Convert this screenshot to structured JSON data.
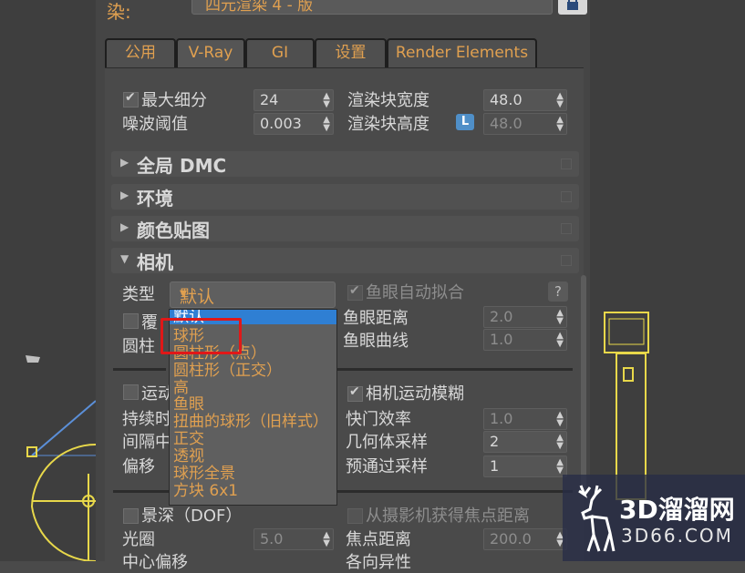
{
  "window": {
    "renderer_prefix": "染:",
    "renderer_value": "四元渲染 4 - 版"
  },
  "tabs": [
    {
      "label": "公用"
    },
    {
      "label": "V-Ray"
    },
    {
      "label": "GI"
    },
    {
      "label": "设置"
    },
    {
      "label": "Render Elements"
    }
  ],
  "image_sampler": {
    "max_subdivs_label": "最大细分",
    "max_subdivs_value": "24",
    "noise_label": "噪波阈值",
    "noise_value": "0.003",
    "bucket_width_label": "渲染块宽度",
    "bucket_width_value": "48.0",
    "bucket_height_label": "渲染块高度",
    "bucket_height_value": "48.0",
    "lock_label": "L"
  },
  "rollouts": [
    {
      "label": "全局 DMC"
    },
    {
      "label": "环境"
    },
    {
      "label": "颜色贴图"
    },
    {
      "label": "相机"
    }
  ],
  "camera": {
    "type_label": "类型",
    "type_value": "默认",
    "fisheye_auto_label": "鱼眼自动拟合",
    "help_label": "?",
    "override_fov_label": "覆",
    "fisheye_dist_label": "鱼眼距离",
    "fisheye_dist_value": "2.0",
    "cylinder_label": "圆柱",
    "fisheye_curve_label": "鱼眼曲线",
    "fisheye_curve_value": "1.0"
  },
  "type_dropdown": {
    "options": [
      "默认",
      "球形",
      "圆柱形（点）",
      "圆柱形（正交）",
      "高",
      "鱼眼",
      "扭曲的球形（旧样式）",
      "正交",
      "透视",
      "球形全景",
      "方块 6x1"
    ],
    "selected_index": 0
  },
  "motion_blur": {
    "motion_label": "运动",
    "camera_mb_label": "相机运动模糊",
    "duration_label": "持续时",
    "shutter_label": "快门效率",
    "shutter_value": "1.0",
    "interval_label": "间隔中",
    "geo_samples_label": "几何体采样",
    "geo_samples_value": "2",
    "bias_label": "偏移",
    "prepass_label": "预通过采样",
    "prepass_value": "1"
  },
  "dof": {
    "dof_label": "景深（DOF）",
    "focus_from_cam_label": "从摄影机获得焦点距离",
    "aperture_label": "光圈",
    "aperture_value": "5.0",
    "focus_dist_label": "焦点距离",
    "focus_dist_value": "200.0",
    "center_bias_label": "中心偏移",
    "anisotropy_label": "各向异性"
  },
  "watermark": {
    "line1": "3D溜溜网",
    "line2": "3D66.COM"
  },
  "colors": {
    "accent": "#e0a050",
    "highlight_box": "#e01818",
    "selection": "#2f7fd3"
  }
}
